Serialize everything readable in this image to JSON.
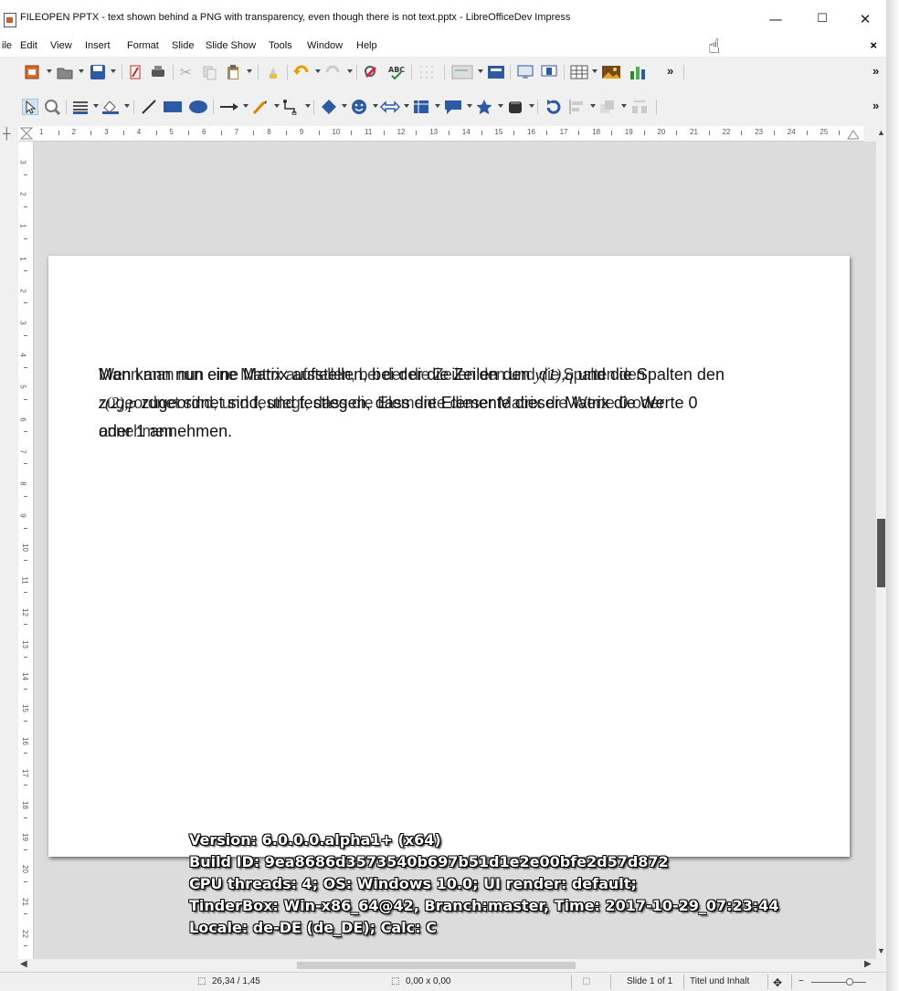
{
  "window": {
    "title": "FILEOPEN PPTX -  text shown behind a PNG with transparency, even though there is not text.pptx - LibreOfficeDev Impress",
    "minimize": "—",
    "maximize": "☐",
    "close": "✕"
  },
  "menu": {
    "items": [
      "ile",
      "Edit",
      "View",
      "Insert",
      "Format",
      "Slide",
      "Slide Show",
      "Tools",
      "Window",
      "Help"
    ],
    "close_doc": "×"
  },
  "toolbar": {
    "overflow": "»"
  },
  "ruler": {
    "h_numbers": [
      "1",
      "2",
      "3",
      "4",
      "5",
      "6",
      "7",
      "8",
      "9",
      "10",
      "11",
      "12",
      "13",
      "14",
      "15",
      "16",
      "17",
      "18",
      "19",
      "20",
      "21",
      "22",
      "23",
      "24",
      "25"
    ],
    "v_numbers": [
      "3",
      "2",
      "1",
      "1",
      "2",
      "3",
      "4",
      "5",
      "6",
      "7",
      "8",
      "9",
      "10",
      "11",
      "12",
      "13",
      "14",
      "15",
      "16",
      "17",
      "18",
      "19",
      "20",
      "21",
      "22"
    ]
  },
  "slide": {
    "line1_a": "Man kann nun eine Matrix aufstellen, bei der die Zeilen den",
    "line1_b": "und die Spalten den",
    "math1": "y(1),q",
    "line2_a": "zugeordnet sind, und festlegen, dass die Elemente dieser Matrix die Werte 0",
    "math2": "z(2),p",
    "line3": "oder 1 annehmen.",
    "ghost1": "Wenn man nun eine Matrix aufstellen, bei der die Zeilen den  und  die Spalten den",
    "ghost2": "zugeordnet sind, und festlegt, dass die Elemente dieser Matrix die Werte 0 oder",
    "ghost3": "annehmen"
  },
  "status": {
    "position": "26,34 / 1,45",
    "size": "0,00 x 0,00",
    "slide": "Slide 1 of 1",
    "layout": "Titel und Inhalt"
  },
  "overlay": {
    "version": "Version: 6.0.0.0.alpha1+ (x64)",
    "build": "Build ID: 9ea8686d3573540b697b51d1e2e00bfe2d57d872",
    "cpu": "CPU threads: 4; OS: Windows 10.0; UI render: default;",
    "tinderbox": "TinderBox: Win-x86_64@42, Branch:master, Time: 2017-10-29_07:23:44",
    "locale": "Locale: de-DE (de_DE); Calc: C"
  }
}
